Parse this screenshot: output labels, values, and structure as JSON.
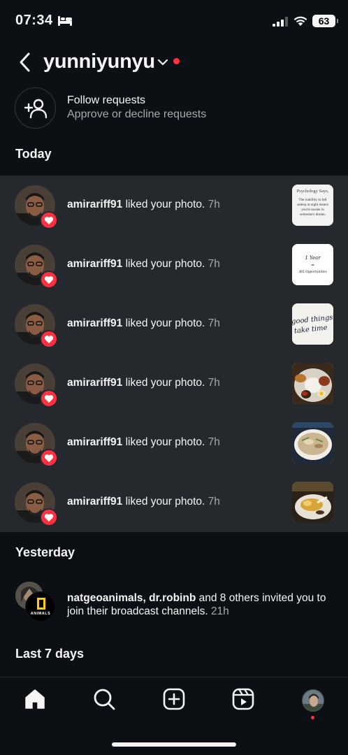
{
  "status_bar": {
    "time": "07:34",
    "battery": "63"
  },
  "header": {
    "account_name": "yunniyunyu"
  },
  "follow_requests": {
    "title": "Follow requests",
    "subtitle": "Approve or decline requests"
  },
  "sections": {
    "today": "Today",
    "yesterday": "Yesterday",
    "last7": "Last 7 days"
  },
  "today_notifications": [
    {
      "user": "amirariff91",
      "action": "liked your photo.",
      "time": "7h",
      "thumb": "psychology-quote-thumbnail"
    },
    {
      "user": "amirariff91",
      "action": "liked your photo.",
      "time": "7h",
      "thumb": "one-year-note-thumbnail"
    },
    {
      "user": "amirariff91",
      "action": "liked your photo.",
      "time": "7h",
      "thumb": "good-things-note-thumbnail"
    },
    {
      "user": "amirariff91",
      "action": "liked your photo.",
      "time": "7h",
      "thumb": "rice-plate-thumbnail"
    },
    {
      "user": "amirariff91",
      "action": "liked your photo.",
      "time": "7h",
      "thumb": "soup-bowl-thumbnail"
    },
    {
      "user": "amirariff91",
      "action": "liked your photo.",
      "time": "7h",
      "thumb": "food-plate-thumbnail"
    }
  ],
  "thumb_text": {
    "psych_title": "Psychology Says,",
    "psych_l1": "The inability to fall",
    "psych_l2": "asleep at night means",
    "psych_l3": "you're awake in",
    "psych_l4": "someone's dream.",
    "one_year_1": "1 Year",
    "one_year_2": "=",
    "one_year_3": "365 Opportunities",
    "good_1": "good things",
    "good_2": "take time"
  },
  "yesterday_notification": {
    "users": "natgeoanimals, dr.robinb",
    "rest": " and 8 others invited you to join their broadcast channels.",
    "time": "21h",
    "badge_text": "ANIMALS"
  },
  "colors": {
    "accent_red": "#ff3040",
    "background": "#0c1014",
    "highlight": "#25292e"
  }
}
